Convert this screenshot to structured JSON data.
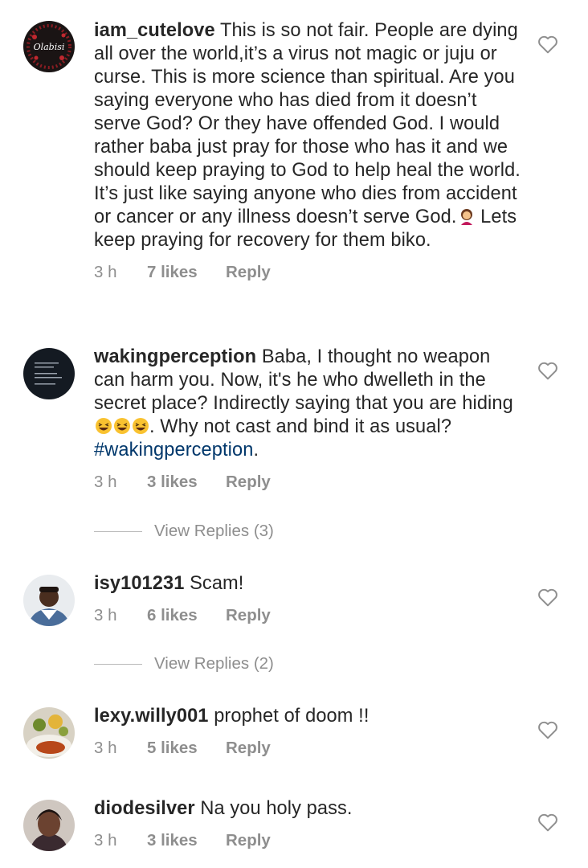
{
  "comments": [
    {
      "username": "iam_cutelove",
      "avatar_label": "Olabisi",
      "text": "This is so not fair. People are dying all over the world,it’s a virus not magic or juju or curse. This is more science than spiritual. Are you saying everyone who has died from it doesn’t serve God? Or they have offended God. I would rather baba just pray for those who has it and we should keep praying to God to help heal the world. It’s just like saying anyone who dies from accident or cancer or any illness doesn’t serve God.",
      "text_after_emoji": "Lets keep praying for recovery for them biko.",
      "time": "3 h",
      "likes": "7 likes",
      "reply": "Reply"
    },
    {
      "username": "wakingperception",
      "text": "Baba, I thought no weapon can harm you. Now, it's he who dwelleth in the secret place? Indirectly saying that you are hiding",
      "text_after_emoji": ". Why not cast and bind it as usual?",
      "hashtag": "#wakingperception",
      "hashtag_suffix": ".",
      "time": "3 h",
      "likes": "3 likes",
      "reply": "Reply",
      "view_replies": "View Replies (3)"
    },
    {
      "username": "isy101231",
      "text": "Scam!",
      "time": "3 h",
      "likes": "6 likes",
      "reply": "Reply",
      "view_replies": "View Replies (2)"
    },
    {
      "username": "lexy.willy001",
      "text": "prophet of doom !!",
      "time": "3 h",
      "likes": "5 likes",
      "reply": "Reply"
    },
    {
      "username": "diodesilver",
      "text": "Na you holy pass.",
      "time": "3 h",
      "likes": "3 likes",
      "reply": "Reply"
    }
  ],
  "icons": {
    "like": "heart-outline-icon",
    "emoji_1": "woman-facepalming-emoji",
    "emoji_2": "grinning-squinting-face-emoji"
  },
  "colors": {
    "text": "#262626",
    "meta": "#8e8e8e",
    "hashtag": "#00376b"
  }
}
